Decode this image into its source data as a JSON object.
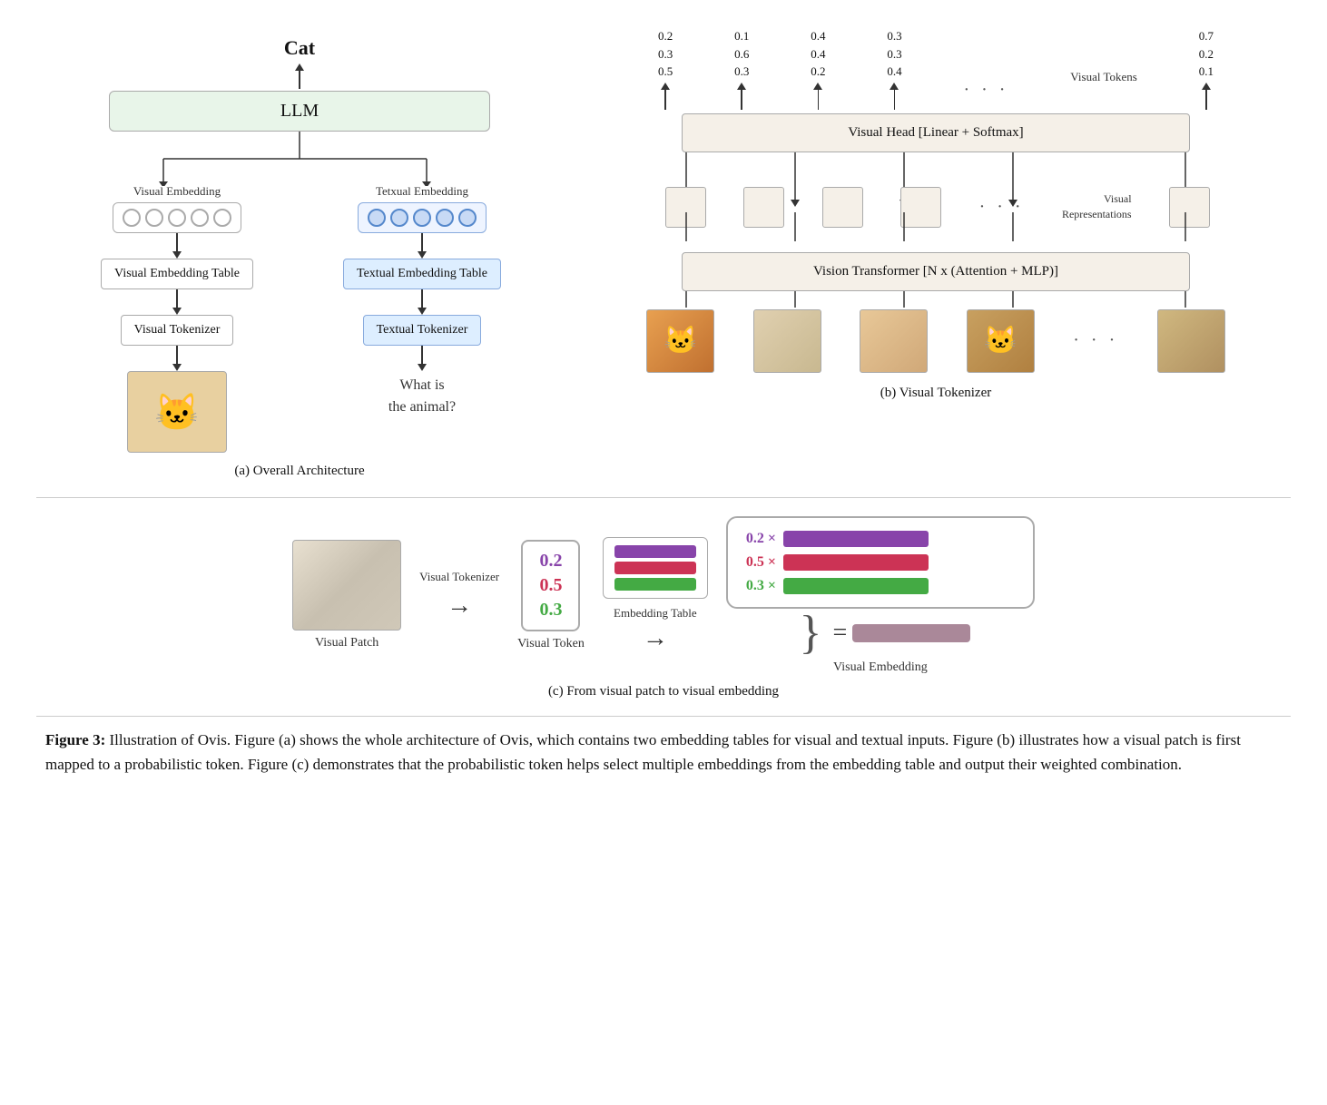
{
  "panelA": {
    "cat_label": "Cat",
    "llm_label": "LLM",
    "visual_embedding_label": "Visual Embedding",
    "textual_embedding_label": "Tetxual Embedding",
    "visual_embedding_table": "Visual Embedding Table",
    "textual_embedding_table": "Textual Embedding Table",
    "visual_tokenizer": "Visual Tokenizer",
    "textual_tokenizer": "Textual Tokenizer",
    "question": "What is\nthe animal?",
    "caption": "(a) Overall Architecture"
  },
  "panelB": {
    "token_cols": [
      {
        "values": "0.2\n0.3\n0.5"
      },
      {
        "values": "0.1\n0.6\n0.3"
      },
      {
        "values": "0.4\n0.4\n0.2"
      },
      {
        "values": "0.3\n0.3\n0.4"
      },
      {
        "values": "0.7\n0.2\n0.1"
      }
    ],
    "dots": "· · ·",
    "visual_tokens_label": "Visual Tokens",
    "visual_head_label": "Visual Head [Linear + Softmax]",
    "visual_representations_label": "Visual\nRepresentations",
    "vit_label": "Vision Transformer [N x (Attention + MLP)]",
    "caption": "(b) Visual Tokenizer"
  },
  "panelC": {
    "visual_patch_label": "Visual Patch",
    "visual_tokenizer_arrow_label": "Visual Tokenizer",
    "token_values": [
      "0.2",
      "0.5",
      "0.3"
    ],
    "token_colors": [
      "purple",
      "red",
      "green"
    ],
    "visual_token_label": "Visual Token",
    "embedding_table_label": "Embedding Table",
    "coefficients": [
      {
        "val": "0.2 ×",
        "color": "purple"
      },
      {
        "val": "0.5 ×",
        "color": "red"
      },
      {
        "val": "0.3 ×",
        "color": "green"
      }
    ],
    "visual_embedding_label": "Visual Embedding",
    "caption": "(c) From visual patch to visual embedding"
  },
  "figureCaption": {
    "bold_part": "Figure 3:",
    "text": " Illustration of Ovis.  Figure (a) shows the whole architecture of Ovis, which contains two embedding tables for visual and textual inputs. Figure (b) illustrates how a visual patch is first mapped to a probabilistic token.  Figure (c) demonstrates that the probabilistic token helps select multiple embeddings from the embedding table and output their weighted combination."
  }
}
